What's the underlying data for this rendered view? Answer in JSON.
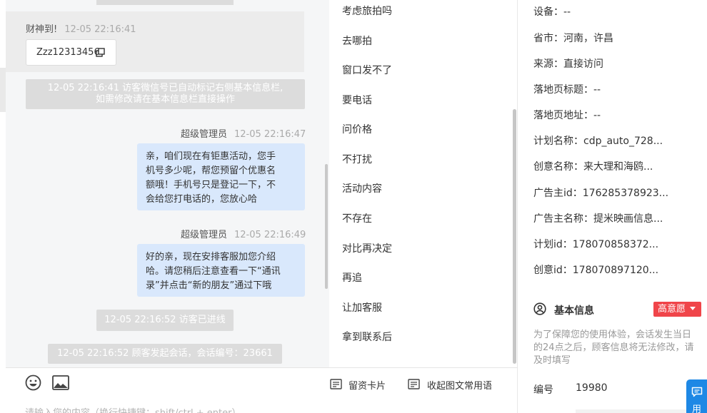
{
  "chat": {
    "msg1": {
      "sender": "财神到!",
      "time": "12-05 22:16:41",
      "text": "Zzz12313456"
    },
    "sys1": {
      "line1": "12-05 22:16:41 访客微信号已自动标记右侧基本信息栏,",
      "line2": "如需修改请在基本信息栏直接操作"
    },
    "msg2": {
      "sender": "超级管理员",
      "time": "12-05 22:16:47",
      "lines": [
        "亲，咱们现在有钜惠活动，您手",
        "机号多少呢，帮您预留个优惠名",
        "额哦！手机号只是登记一下，不",
        "会给您打电话的，您放心哈"
      ]
    },
    "msg3": {
      "sender": "超级管理员",
      "time": "12-05 22:16:49",
      "lines": [
        "好的亲，现在安排客服加您介绍",
        "哈。请您稍后注意查看一下“通讯",
        "录”并点击“新的朋友”通过下哦"
      ]
    },
    "sys2": "12-05 22:16:52 访客已进线",
    "sys3": "12-05 22:16:52 顾客发起会话，会话编号：23661"
  },
  "quick_replies": [
    "考虑旅拍吗",
    "去哪拍",
    "窗口发不了",
    "要电话",
    "问价格",
    "不打扰",
    "活动内容",
    "不存在",
    "对比再决定",
    "再追",
    "让加客服",
    "拿到联系后"
  ],
  "info": {
    "device": "设备：--",
    "province": "省市：河南，许昌",
    "source": "来源：直接访问",
    "landing_title": "落地页标题：--",
    "landing_url": "落地页地址：--",
    "plan_name": "计划名称：cdp_auto_728...",
    "creative_name": "创意名称：来大理和海鸥...",
    "advertiser_id": "广告主id：176285378923...",
    "advertiser_name": "广告主名称：提米映画信息...",
    "plan_id": "计划id：178070858372...",
    "creative_id": "创意id：178070897120...",
    "basic_title": "基本信息",
    "intent_badge": "高意愿",
    "notice": [
      "为了保障您的使用体验，会话发生当日",
      "的24点之后，顾客信息将无法修改，请",
      "及时填写"
    ],
    "number_label": "编号",
    "number_value": "19980",
    "float_btn": "用"
  },
  "toolbar": {
    "card": "留资卡片",
    "collapse": "收起图文常用语",
    "placeholder": "请输入您的内容（换行快捷键：shift/ctrl + enter）"
  },
  "colors": {
    "badge": "#f0454a",
    "bubble": "#d9e8fc",
    "float": "#1e88e5"
  }
}
